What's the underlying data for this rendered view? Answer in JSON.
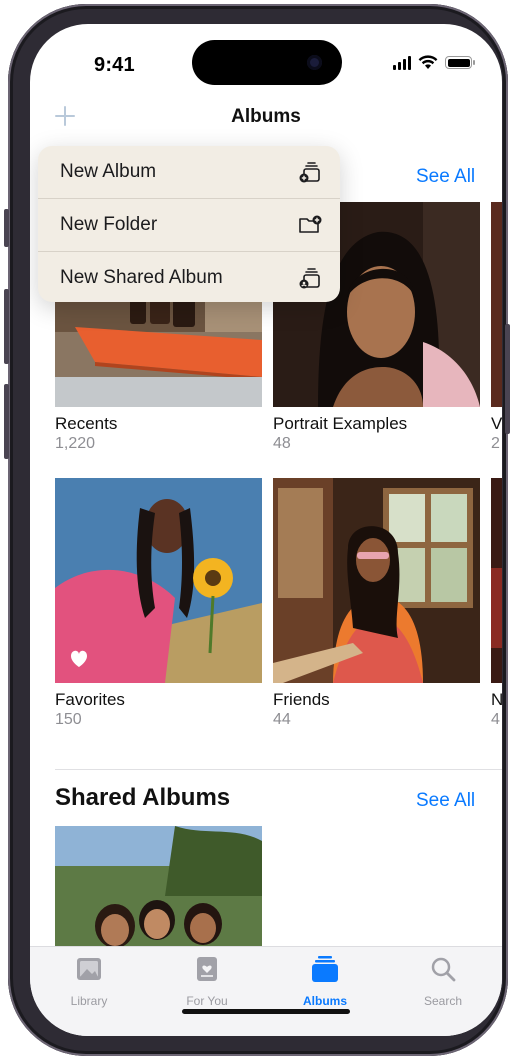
{
  "status_bar": {
    "time": "9:41"
  },
  "nav": {
    "title": "Albums",
    "add_icon": "plus-icon"
  },
  "menu": {
    "items": [
      {
        "label": "New Album",
        "icon": "new-album-icon"
      },
      {
        "label": "New Folder",
        "icon": "new-folder-icon"
      },
      {
        "label": "New Shared Album",
        "icon": "new-shared-album-icon"
      }
    ]
  },
  "my_albums": {
    "see_all": "See All",
    "albums": [
      {
        "name": "Recents",
        "count": "1,220"
      },
      {
        "name": "Portrait Examples",
        "count": "48"
      },
      {
        "name": "V",
        "count": "2"
      },
      {
        "name": "Favorites",
        "count": "150"
      },
      {
        "name": "Friends",
        "count": "44"
      },
      {
        "name": "N",
        "count": "4"
      }
    ]
  },
  "shared_albums": {
    "title": "Shared Albums",
    "see_all": "See All"
  },
  "tab_bar": {
    "tabs": [
      {
        "label": "Library",
        "icon": "library-icon"
      },
      {
        "label": "For You",
        "icon": "for-you-icon"
      },
      {
        "label": "Albums",
        "icon": "albums-icon",
        "active": true
      },
      {
        "label": "Search",
        "icon": "search-icon"
      }
    ]
  },
  "colors": {
    "accent": "#0a7aff",
    "menu_bg": "#f2ede4",
    "frame": "#2e2b34"
  }
}
